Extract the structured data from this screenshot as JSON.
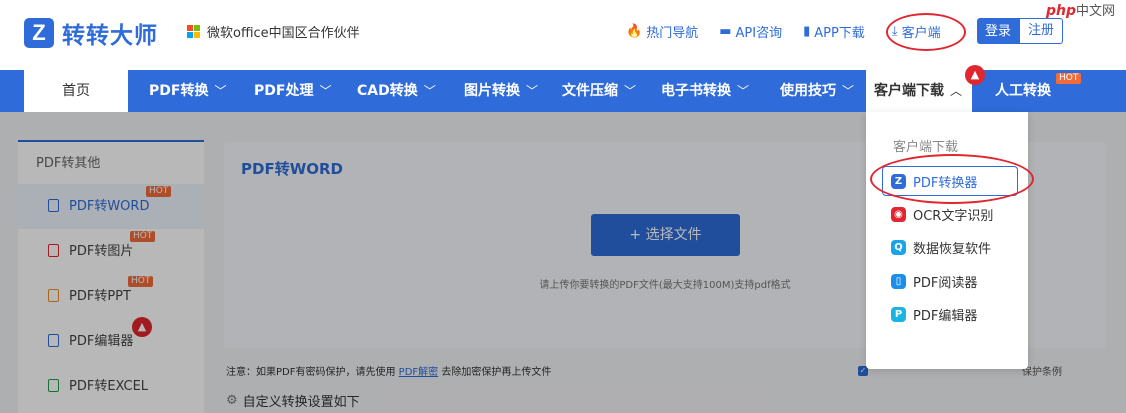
{
  "header": {
    "logo_mark": "Z",
    "logo_text": "转转大师",
    "partner": "微软office中国区合作伙伴",
    "links": [
      {
        "label": "热门导航",
        "icon": "fire-icon"
      },
      {
        "label": "API咨询",
        "icon": "chat-icon"
      },
      {
        "label": "APP下载",
        "icon": "phone-icon"
      },
      {
        "label": "客户端",
        "icon": "download-icon"
      }
    ],
    "login": "登录",
    "register": "注册",
    "watermark_logo": "php",
    "watermark_text": "中文网"
  },
  "nav": {
    "home": "首页",
    "items": [
      "PDF转换",
      "PDF处理",
      "CAD转换",
      "图片转换",
      "文件压缩",
      "电子书转换",
      "使用技巧"
    ],
    "client_download": "客户端下载",
    "manual": "人工转换",
    "hot": "HOT"
  },
  "sidebar": {
    "title": "PDF转其他",
    "items": [
      {
        "label": "PDF转WORD",
        "color": "#2f6cd9"
      },
      {
        "label": "PDF转图片",
        "color": "#e0262f"
      },
      {
        "label": "PDF转PPT",
        "color": "#f08a24"
      },
      {
        "label": "PDF编辑器",
        "color": "#2f6cd9"
      },
      {
        "label": "PDF转EXCEL",
        "color": "#1e9e4a"
      }
    ]
  },
  "panel": {
    "title": "PDF转WORD",
    "select_button": "+ 选择文件",
    "upload_tip": "请上传你要转换的PDF文件(最大支持100M)支持pdf格式"
  },
  "note": {
    "prefix": "注意：如果PDF有密码保护，请先使用",
    "link": "PDF解密",
    "suffix": "去除加密保护再上传文件",
    "right": "保护条例"
  },
  "custom_settings": "自定义转换设置如下",
  "dropdown": {
    "title": "客户端下载",
    "items": [
      {
        "label": "PDF转换器",
        "icon": "Z",
        "color": "#2f6cd9"
      },
      {
        "label": "OCR文字识别",
        "icon": "◉",
        "color": "#e0262f"
      },
      {
        "label": "数据恢复软件",
        "icon": "Q",
        "color": "#1aa3e8"
      },
      {
        "label": "PDF阅读器",
        "icon": "▯",
        "color": "#1a8ee8"
      },
      {
        "label": "PDF编辑器",
        "icon": "P",
        "color": "#19b5e0"
      }
    ]
  },
  "colors": {
    "brand": "#2f6cd9",
    "highlight_red": "#e0262f",
    "hot": "#f26b3a"
  }
}
